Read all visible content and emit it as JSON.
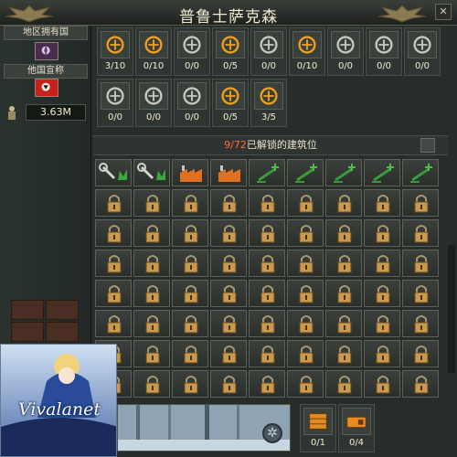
{
  "window": {
    "title": "普鲁士萨克森",
    "close_glyph": "✕"
  },
  "left": {
    "region_owner_label": "地区拥有国",
    "claimant_label": "他国宣称",
    "money": "3.63M"
  },
  "resources_row1": [
    {
      "icon": "flame-icon",
      "value": "3/10",
      "color": "#f0a020"
    },
    {
      "icon": "artillery-icon",
      "value": "0/10",
      "color": "#f0a020"
    },
    {
      "icon": "tank-icon",
      "value": "0/0",
      "color": "#c8c8c0"
    },
    {
      "icon": "plane-icon",
      "value": "0/5",
      "color": "#f0a020"
    },
    {
      "icon": "robot-arm-icon",
      "value": "0/0",
      "color": "#c8c8c0"
    },
    {
      "icon": "oil-barrel-icon",
      "value": "0/10",
      "color": "#f0a020"
    },
    {
      "icon": "radar-icon",
      "value": "0/0",
      "color": "#c8c8c0"
    },
    {
      "icon": "rocket-launcher-icon",
      "value": "0/0",
      "color": "#c8c8c0"
    },
    {
      "icon": "missile-icon",
      "value": "0/0",
      "color": "#c8c8c0"
    }
  ],
  "resources_row2": [
    {
      "icon": "atom-icon",
      "value": "0/0",
      "color": "#c8c8c0"
    },
    {
      "icon": "atom-icon",
      "value": "0/0",
      "color": "#c8c8c0"
    },
    {
      "icon": "reactor-icon",
      "value": "0/0",
      "color": "#c8c8c0"
    },
    {
      "icon": "chemical-plant-icon",
      "value": "0/5",
      "color": "#f0a020"
    },
    {
      "icon": "railway-icon",
      "value": "3/5",
      "color": "#f0a020"
    }
  ],
  "buildings": {
    "unlocked_count": "9/72",
    "unlocked_suffix": "已解锁的建筑位",
    "unlocked_slots": [
      "wrench-green-icon",
      "wrench-green-icon",
      "factory-orange-icon",
      "factory-orange-icon",
      "build-green-icon",
      "build-green-icon",
      "build-green-icon",
      "build-green-icon",
      "build-green-icon"
    ],
    "locked_rows": 7,
    "columns": 9
  },
  "bottom": {
    "card1_value": "0/1",
    "card2_value": "0/4",
    "gear_glyph": "✲"
  },
  "avatar": {
    "logo_text": "Vivalanet"
  }
}
